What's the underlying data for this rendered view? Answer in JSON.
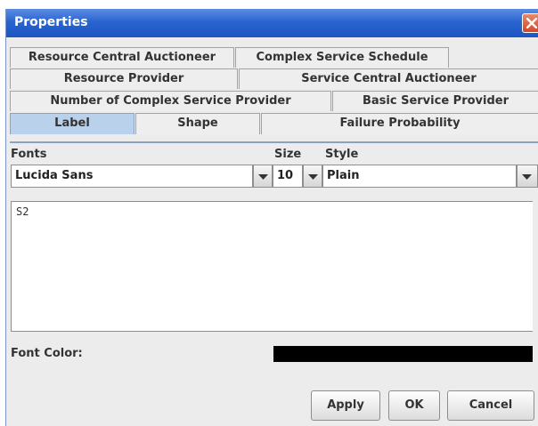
{
  "window": {
    "title": "Properties"
  },
  "tabs": {
    "row1": [
      "Resource Central Auctioneer",
      "Complex Service Schedule"
    ],
    "row2": [
      "Resource Provider",
      "Service Central Auctioneer"
    ],
    "row3": [
      "Number of Complex Service Provider",
      "Basic Service Provider"
    ],
    "row4": [
      "Label",
      "Shape",
      "Failure Probability"
    ],
    "active": "Label"
  },
  "form": {
    "fonts_label": "Fonts",
    "size_label": "Size",
    "style_label": "Style",
    "font_value": "Lucida Sans",
    "size_value": "10",
    "style_value": "Plain",
    "text_value": "S2",
    "font_color_label": "Font Color:",
    "font_color": "#000000"
  },
  "buttons": {
    "apply": "Apply",
    "ok": "OK",
    "cancel": "Cancel"
  }
}
